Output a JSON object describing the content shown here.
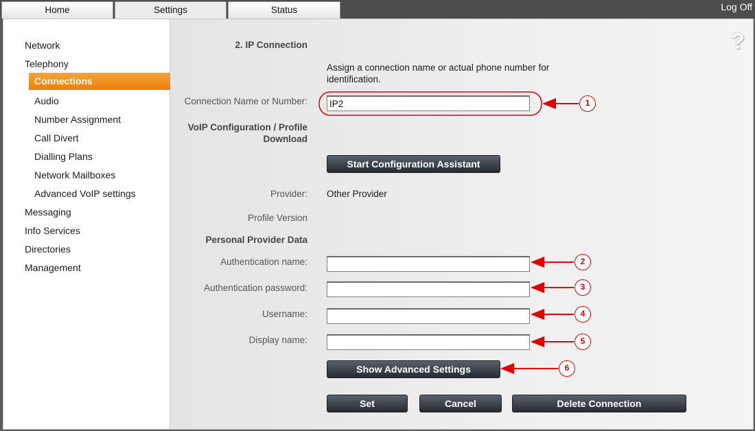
{
  "tabs": {
    "home": "Home",
    "settings": "Settings",
    "status": "Status"
  },
  "logoff": "Log Off",
  "sidebar": {
    "network": "Network",
    "telephony": "Telephony",
    "connections": "Connections",
    "audio": "Audio",
    "number_assignment": "Number Assignment",
    "call_divert": "Call Divert",
    "dialling_plans": "Dialling Plans",
    "network_mailboxes": "Network Mailboxes",
    "advanced_voip": "Advanced VoIP settings",
    "messaging": "Messaging",
    "info_services": "Info Services",
    "directories": "Directories",
    "management": "Management"
  },
  "form": {
    "section_title": "2. IP Connection",
    "instructions_line1": "Assign a connection name or actual phone number for",
    "instructions_line2": "identification.",
    "connection_name_label": "Connection Name or Number:",
    "connection_name_value": "IP2",
    "voip_config_line1": "VoIP Configuration / Profile",
    "voip_config_line2": "Download",
    "start_assistant_button": "Start Configuration Assistant",
    "provider_label": "Provider:",
    "provider_value": "Other Provider",
    "profile_version_label": "Profile Version",
    "personal_data_title": "Personal Provider Data",
    "auth_name_label": "Authentication name:",
    "auth_name_value": "",
    "auth_password_label": "Authentication password:",
    "auth_password_value": "",
    "username_label": "Username:",
    "username_value": "",
    "display_name_label": "Display name:",
    "display_name_value": "",
    "show_advanced_button": "Show Advanced Settings",
    "set_button": "Set",
    "cancel_button": "Cancel",
    "delete_button": "Delete Connection"
  },
  "callouts": [
    "1",
    "2",
    "3",
    "4",
    "5",
    "6"
  ],
  "colors": {
    "accent": "#ec7e0c",
    "callout": "#e00000",
    "button": "#2f343a"
  }
}
